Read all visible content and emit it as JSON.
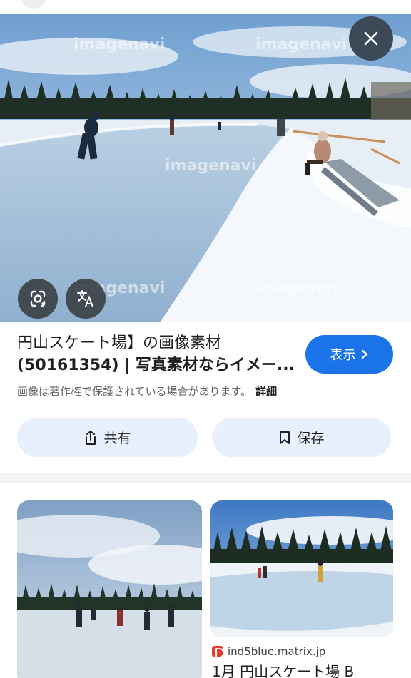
{
  "hero": {
    "watermark": "imagenavi",
    "close_icon": "close-icon",
    "lens_icon": "google-lens-icon",
    "translate_icon": "translate-icon"
  },
  "result": {
    "title_line1": "円山スケート場】の画像素材",
    "title_line2": "(50161354) | 写真素材ならイメー...",
    "visit_label": "表示",
    "copyright_note": "画像は著作権で保護されている場合があります。",
    "details_link": "詳細"
  },
  "actions": {
    "share_label": "共有",
    "save_label": "保存"
  },
  "related": [
    {
      "source": "",
      "title": ""
    },
    {
      "source": "ind5blue.matrix.jp",
      "title": "1月 円山スケート場 B"
    }
  ],
  "colors": {
    "accent": "#1a73e8",
    "pill_bg": "#e8f0fe",
    "close_bg": "#3c4a57"
  }
}
